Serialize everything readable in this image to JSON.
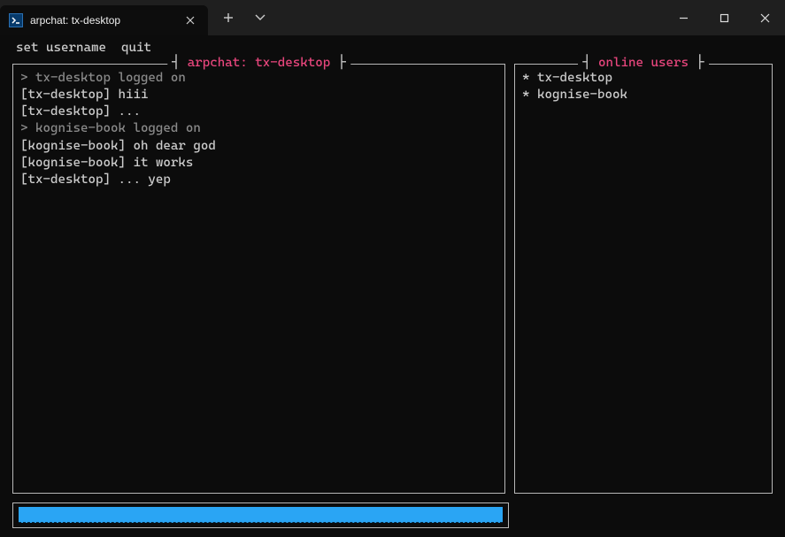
{
  "window": {
    "tab_title": "arpchat: tx-desktop"
  },
  "menu": {
    "set_username": "set username",
    "quit": "quit"
  },
  "panels": {
    "chat_title": "arpchat: tx-desktop",
    "users_title": "online users"
  },
  "log": [
    {
      "type": "sys",
      "text": "> tx-desktop logged on"
    },
    {
      "type": "msg",
      "who": "tx-desktop",
      "text": "hiii"
    },
    {
      "type": "msg",
      "who": "tx-desktop",
      "text": "..."
    },
    {
      "type": "sys",
      "text": "> kognise-book logged on"
    },
    {
      "type": "msg",
      "who": "kognise-book",
      "text": "oh dear god"
    },
    {
      "type": "msg",
      "who": "kognise-book",
      "text": "it works"
    },
    {
      "type": "msg",
      "who": "tx-desktop",
      "text": "... yep"
    }
  ],
  "users": [
    "tx-desktop",
    "kognise-book"
  ],
  "input": {
    "value": ""
  },
  "colors": {
    "accent": "#e8467d",
    "input_bg": "#2aa5f4"
  }
}
